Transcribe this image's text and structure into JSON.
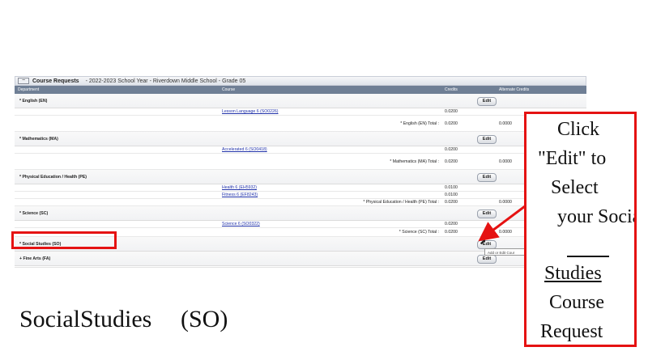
{
  "panel": {
    "collapse_symbol": "−",
    "title": "Course Requests",
    "subtitle": "- 2022-2023 School Year - Riverdown Middle School - Grade 05"
  },
  "columns": [
    "Department",
    "Course",
    "Credits",
    "Alternate Credits"
  ],
  "rows": [
    {
      "kind": "group",
      "label": "* English (EN)",
      "edit": "Edit"
    },
    {
      "kind": "course",
      "course": "Lesson Language 6 (SO0226)",
      "credits": "0.0200"
    },
    {
      "kind": "total",
      "label": "* English (EN) Total :",
      "credits": "0.0200",
      "alt": "0.0000"
    },
    {
      "kind": "group",
      "label": "* Mathematics (MA)",
      "edit": "Edit"
    },
    {
      "kind": "course",
      "course": "Accelerated 6 (SO0418)",
      "credits": "0.0200"
    },
    {
      "kind": "total",
      "label": "* Mathematics (MA) Total :",
      "credits": "0.0200",
      "alt": "0.0000"
    },
    {
      "kind": "group",
      "label": "* Physical Education / Health (PE)",
      "edit": "Edit"
    },
    {
      "kind": "course",
      "course": "Health 6 (EH5932)",
      "credits": "0.0100"
    },
    {
      "kind": "course",
      "course": "Fitness 6 (EF8243)",
      "credits": "0.0100"
    },
    {
      "kind": "total",
      "label": "* Physical Education / Health (PE) Total :",
      "credits": "0.0200",
      "alt": "0.0000"
    },
    {
      "kind": "group",
      "label": "* Science (SC)",
      "edit": "Edit"
    },
    {
      "kind": "course",
      "course": "Science 6 (SO0322)",
      "credits": "0.0200"
    },
    {
      "kind": "total",
      "label": "* Science (SC) Total :",
      "credits": "0.0200",
      "alt": "0.0000"
    },
    {
      "kind": "group",
      "label": "* Social Studies (SO)",
      "edit": "Edit"
    },
    {
      "kind": "group",
      "label": "+ Fine Arts (FA)",
      "edit": "Edit"
    }
  ],
  "tooltip": "Add or Edit Cour",
  "callout": {
    "lines": [
      "Click",
      "\"Edit\"  to",
      "Select",
      "your Socia",
      "Studies",
      "Course",
      "Request"
    ]
  },
  "caption": {
    "text": "SocialStudies",
    "abbr": "(SO)"
  },
  "colors": {
    "highlight": "#e51212",
    "header": "#6f7f95",
    "link": "#2233aa"
  }
}
